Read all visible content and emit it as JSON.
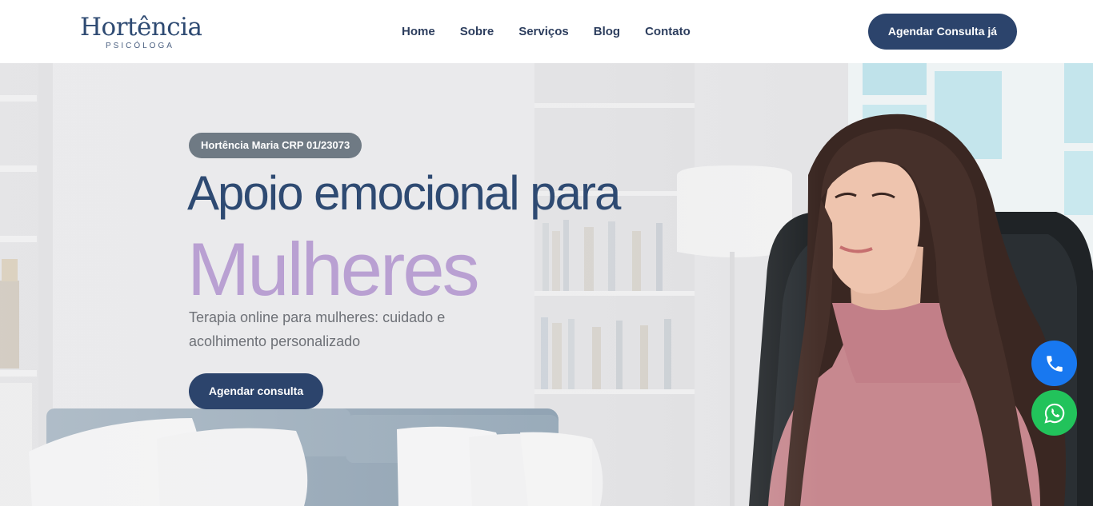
{
  "header": {
    "logo_name": "Hortência",
    "logo_sub": "PSICÓLOGA",
    "nav": [
      "Home",
      "Sobre",
      "Serviços",
      "Blog",
      "Contato"
    ],
    "cta_label": "Agendar Consulta já"
  },
  "hero": {
    "badge": "Hortência Maria CRP 01/23073",
    "title_line1": "Apoio emocional para",
    "title_line2": "Mulheres",
    "subtitle": "Terapia online para mulheres: cuidado e acolhimento personalizado",
    "cta_label": "Agendar consulta"
  },
  "floating": {
    "phone_icon": "phone-icon",
    "whatsapp_icon": "whatsapp-icon"
  },
  "colors": {
    "brand_navy": "#2c446c",
    "accent_lilac": "#b9a0d2",
    "badge_gray": "#6f7a84",
    "phone_blue": "#1878f0",
    "whatsapp_green": "#22c35b"
  }
}
